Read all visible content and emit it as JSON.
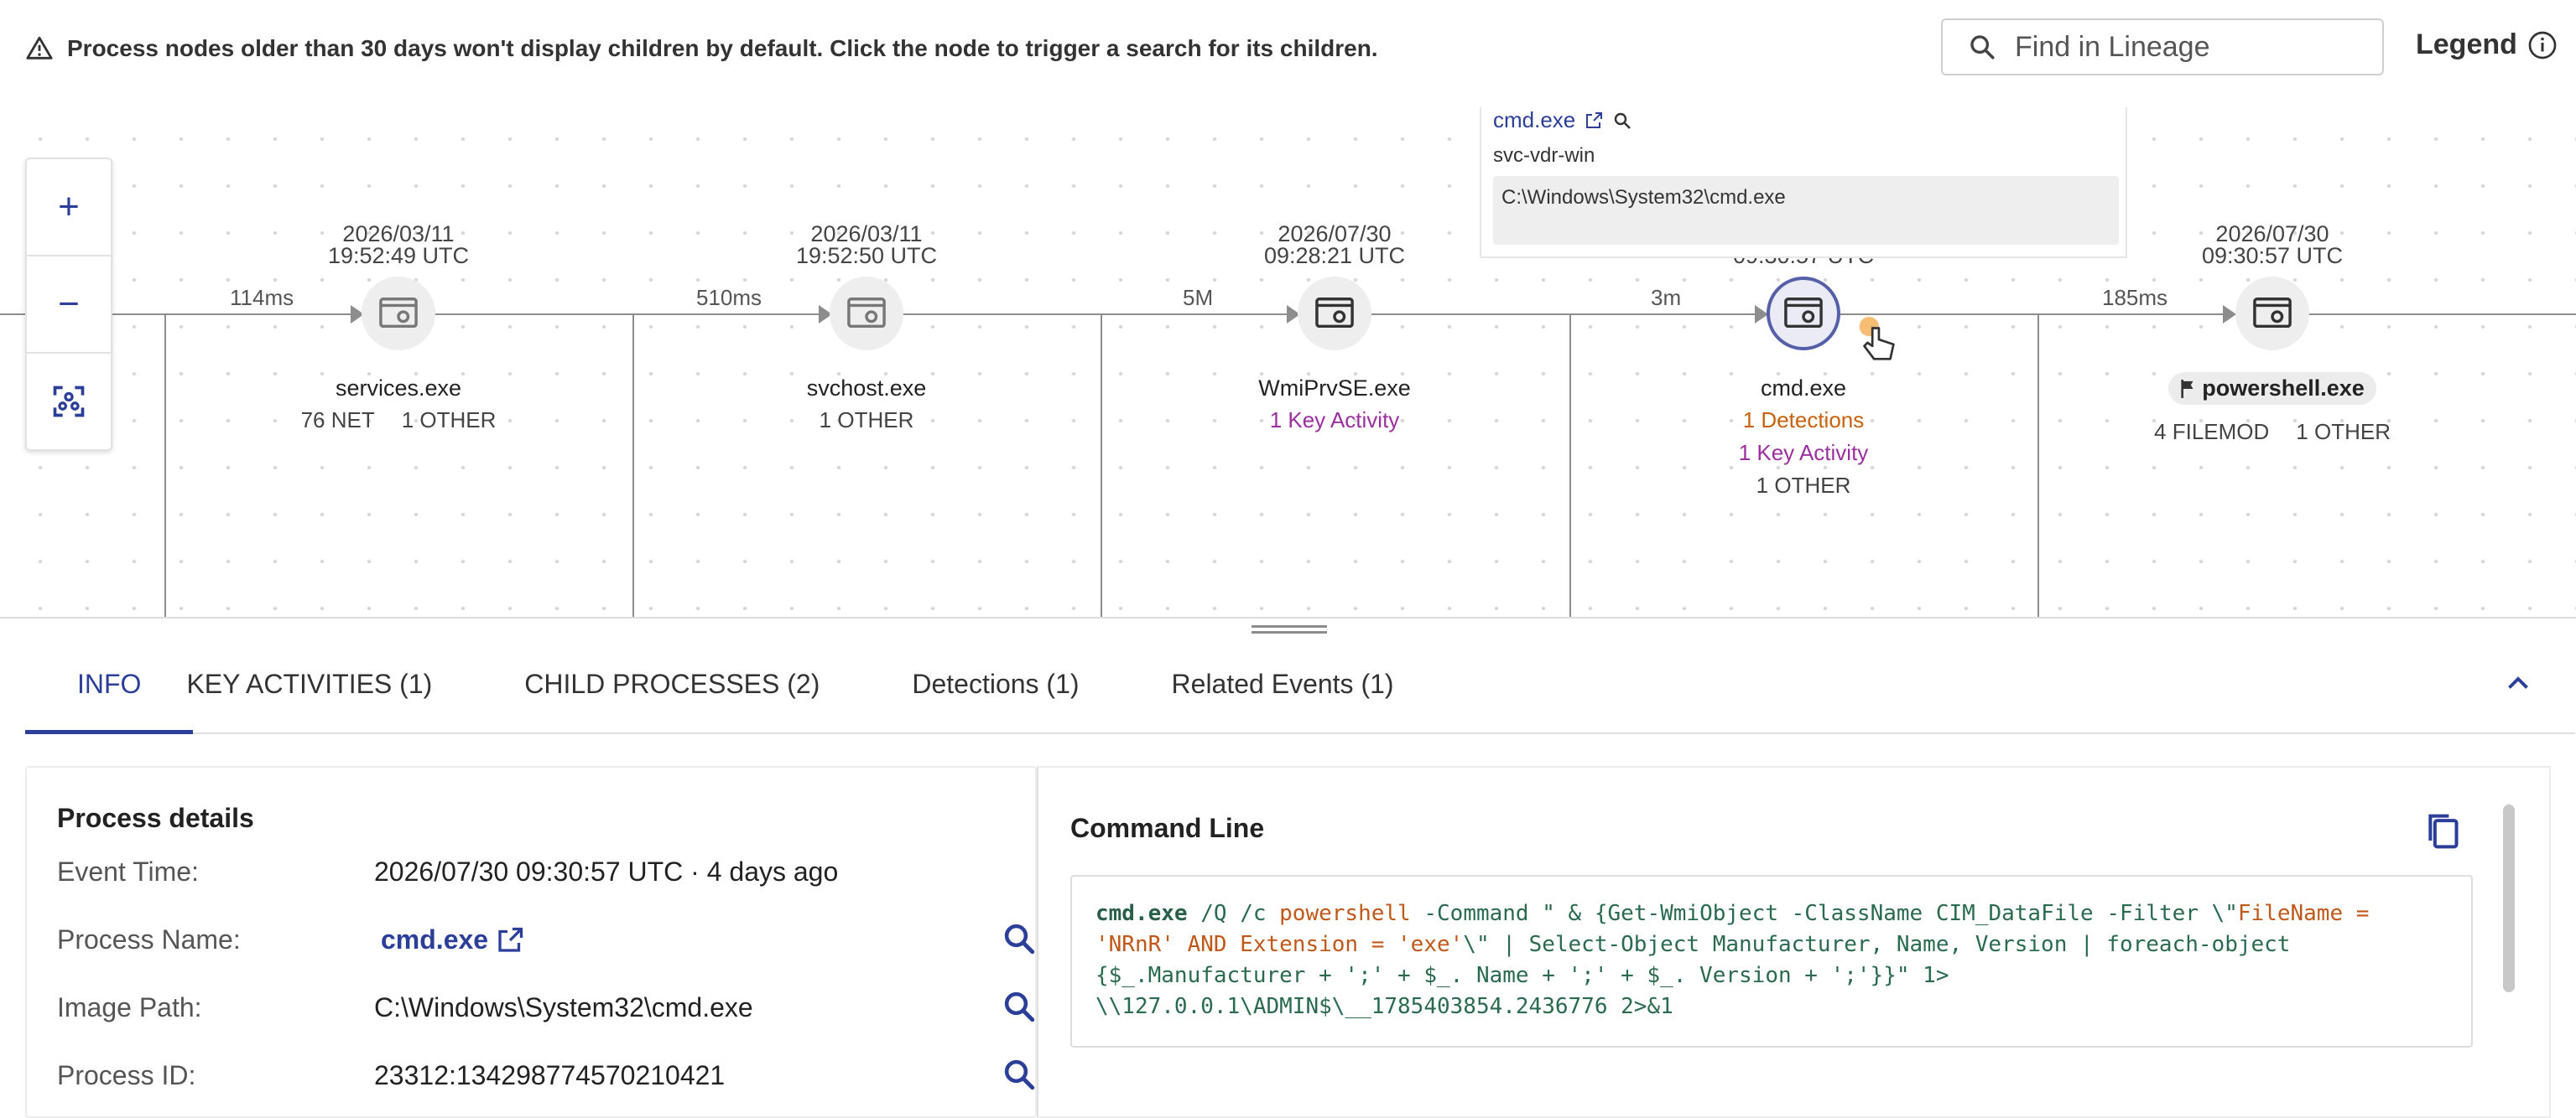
{
  "banner": {
    "text": "Process nodes older than 30 days won't display children by default. Click the node to trigger a search for its children."
  },
  "search": {
    "placeholder": "Find in Lineage"
  },
  "legend": {
    "label": "Legend"
  },
  "edges": [
    {
      "label": "114ms"
    },
    {
      "label": "510ms"
    },
    {
      "label": "5M"
    },
    {
      "label": "3m"
    },
    {
      "label": "185ms"
    }
  ],
  "nodes": [
    {
      "date": "2026/03/11",
      "time": "19:52:49 UTC",
      "name": "services.exe",
      "meta1": "76 NET",
      "meta2": "1 OTHER"
    },
    {
      "date": "2026/03/11",
      "time": "19:52:50 UTC",
      "name": "svchost.exe",
      "meta1": "1 OTHER"
    },
    {
      "date": "2026/07/30",
      "time": "09:28:21 UTC",
      "name": "WmiPrvSE.exe",
      "meta1": "1 Key Activity"
    },
    {
      "date": "",
      "time": "09:30:57 UTC",
      "name": "cmd.exe",
      "meta1": "1 Detections",
      "meta2": "1 Key Activity",
      "meta3": "1 OTHER"
    },
    {
      "date": "2026/07/30",
      "time": "09:30:57 UTC",
      "name": "powershell.exe",
      "meta1": "4 FILEMOD",
      "meta2": "1 OTHER"
    }
  ],
  "tooltip": {
    "title": "cmd.exe",
    "host": "svc-vdr-win",
    "path": "C:\\Windows\\System32\\cmd.exe"
  },
  "zoom": {
    "in": "+",
    "out": "−"
  },
  "tabs": [
    {
      "label": "INFO"
    },
    {
      "label": "KEY ACTIVITIES (1)"
    },
    {
      "label": "CHILD PROCESSES (2)"
    },
    {
      "label": "Detections (1)"
    },
    {
      "label": "Related Events (1)"
    }
  ],
  "details": {
    "title": "Process details",
    "rows": [
      {
        "label": "Event Time:",
        "value": "2026/07/30 09:30:57 UTC · 4 days ago"
      },
      {
        "label": "Process Name:",
        "value": "cmd.exe"
      },
      {
        "label": "Image Path:",
        "value": "C:\\Windows\\System32\\cmd.exe"
      },
      {
        "label": "Process ID:",
        "value": "23312:134298774570210421"
      }
    ]
  },
  "command": {
    "title": "Command Line",
    "p1": "cmd.exe",
    "p2": " /Q /c ",
    "p3": "powershell",
    "p4": " -Command \" & {Get-WmiObject -ClassName CIM_DataFile -Filter \\\"",
    "p5": "FileName =\n'NRnR' AND Extension = 'exe'",
    "p6": "\\\" | Select-Object Manufacturer, Name, Version | foreach-object\n{$_.Manufacturer + ';' + $_. Name + ';' + $_. Version + ';'}}\" 1>\n\\\\127.0.0.1\\ADMIN$\\__1785403854.2436776 2>&1"
  },
  "colors": {
    "accent": "#2b3f99",
    "detection": "#c8610c",
    "key_activity": "#9c2fa0"
  }
}
